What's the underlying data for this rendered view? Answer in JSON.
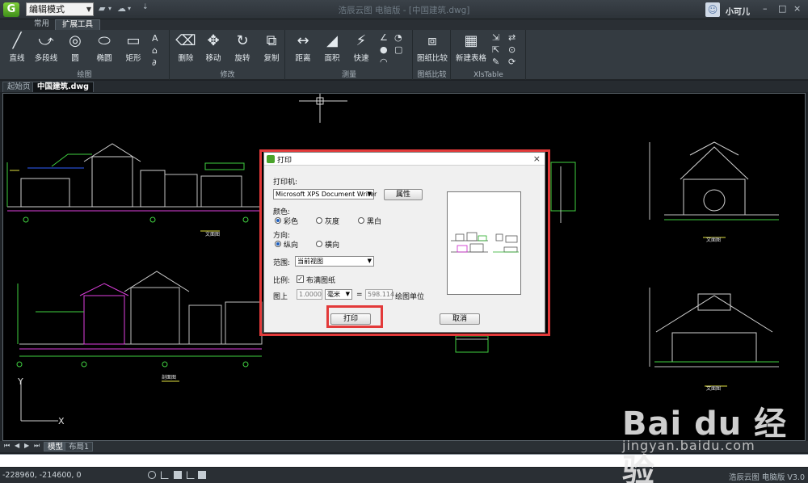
{
  "titlebar": {
    "logo_letter": "G",
    "mode": "编辑模式",
    "window_title": "浩辰云图 电脑版 - [中国建筑.dwg]",
    "user_name": "小可儿",
    "buttons": [
      "–",
      "□",
      "×"
    ]
  },
  "ribbon": {
    "tabs": [
      "常用",
      "扩展工具"
    ],
    "active_tab": "扩展工具",
    "groups": {
      "draw": {
        "label": "绘图",
        "items": [
          {
            "label": "直线",
            "icon": "line-icon"
          },
          {
            "label": "多段线",
            "icon": "polyline-icon"
          },
          {
            "label": "圆",
            "icon": "circle-icon"
          },
          {
            "label": "椭圆",
            "icon": "ellipse-icon"
          },
          {
            "label": "矩形",
            "icon": "rectangle-icon"
          }
        ]
      },
      "modify": {
        "label": "修改",
        "items": [
          {
            "label": "删除",
            "icon": "eraser-icon"
          },
          {
            "label": "移动",
            "icon": "move-icon"
          },
          {
            "label": "旋转",
            "icon": "rotate-icon"
          },
          {
            "label": "复制",
            "icon": "copy-icon"
          }
        ]
      },
      "measure": {
        "label": "测量",
        "items": [
          {
            "label": "距离",
            "icon": "distance-icon"
          },
          {
            "label": "面积",
            "icon": "area-icon"
          },
          {
            "label": "快速",
            "icon": "quick-measure-icon"
          }
        ]
      },
      "compare": {
        "label": "图纸比较",
        "items": [
          {
            "label": "图纸比较",
            "icon": "compare-icon"
          }
        ]
      },
      "xlstable": {
        "label": "XlsTable",
        "items": [
          {
            "label": "新建表格",
            "icon": "table-icon"
          }
        ]
      }
    }
  },
  "doc_tabs": [
    "起始页",
    "中国建筑.dwg"
  ],
  "canvas": {
    "drawing_labels": [
      "文面图",
      "文面图",
      "剖面图",
      "文面图",
      "文面图"
    ]
  },
  "print_dialog": {
    "title": "打印",
    "printer_label": "打印机:",
    "printer_value": "Microsoft XPS Document Writer",
    "properties_button": "属性",
    "color_label": "颜色:",
    "color_options": [
      "彩色",
      "灰度",
      "黑白"
    ],
    "color_selected": "彩色",
    "orientation_label": "方向:",
    "orientation_options": [
      "纵向",
      "横向"
    ],
    "orientation_selected": "纵向",
    "range_label": "范围:",
    "range_value": "当前视图",
    "scale_label": "比例:",
    "fit_label": "布满图纸",
    "fit_checked": true,
    "paper_label": "图上",
    "paper_value": "1.0000",
    "unit_value": "毫米",
    "equals": "=",
    "drawing_value": "598.114",
    "drawing_unit_label": "绘图单位",
    "print_button": "打印",
    "cancel_button": "取消"
  },
  "layout_tabs": [
    "模型",
    "布局1"
  ],
  "status": {
    "coords": "-228960, -214600, 0",
    "version": "浩辰云图 电脑版 V3.0"
  },
  "watermark": {
    "text": "Bai du 经验",
    "url": "jingyan.baidu.com"
  },
  "colors": {
    "highlight": "#e33a3a",
    "canvas_bg": "#000000",
    "ribbon_bg": "#343b41"
  }
}
